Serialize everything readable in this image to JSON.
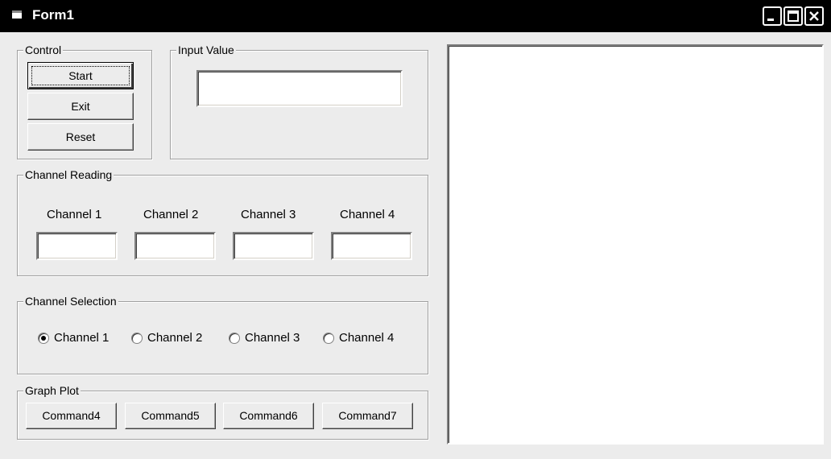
{
  "window": {
    "title": "Form1"
  },
  "control": {
    "label": "Control",
    "start": "Start",
    "exit": "Exit",
    "reset": "Reset"
  },
  "input_value": {
    "label": "Input Value",
    "value": ""
  },
  "channel_reading": {
    "label": "Channel Reading",
    "channels": [
      {
        "label": "Channel 1",
        "value": ""
      },
      {
        "label": "Channel 2",
        "value": ""
      },
      {
        "label": "Channel 3",
        "value": ""
      },
      {
        "label": "Channel 4",
        "value": ""
      }
    ]
  },
  "channel_selection": {
    "label": "Channel Selection",
    "options": [
      {
        "label": "Channel 1",
        "checked": true
      },
      {
        "label": "Channel 2",
        "checked": false
      },
      {
        "label": "Channel 3",
        "checked": false
      },
      {
        "label": "Channel 4",
        "checked": false
      }
    ]
  },
  "graph_plot": {
    "label": "Graph Plot",
    "buttons": [
      "Command4",
      "Command5",
      "Command6",
      "Command7"
    ]
  }
}
